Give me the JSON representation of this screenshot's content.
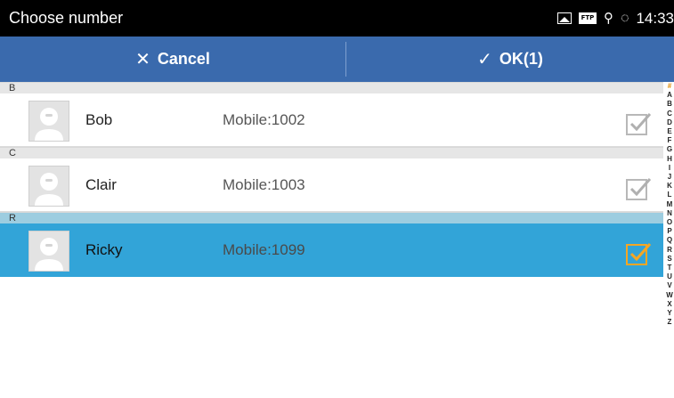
{
  "statusbar": {
    "title": "Choose number",
    "icons": [
      "picture-icon",
      "ftp-icon",
      "usb-icon",
      "sync-icon"
    ],
    "ftp_label": "FTP",
    "time": "14:33"
  },
  "actionbar": {
    "cancel_label": "Cancel",
    "ok_label": "OK(1)",
    "background": "#3a6aad"
  },
  "sections": [
    {
      "letter": "B",
      "contacts": [
        {
          "name": "Bob",
          "phone": "Mobile:1002",
          "checked": false
        }
      ]
    },
    {
      "letter": "C",
      "contacts": [
        {
          "name": "Clair",
          "phone": "Mobile:1003",
          "checked": false
        }
      ]
    },
    {
      "letter": "R",
      "contacts": [
        {
          "name": "Ricky",
          "phone": "Mobile:1099",
          "checked": true
        }
      ]
    }
  ],
  "index_letters": [
    "#",
    "A",
    "B",
    "C",
    "D",
    "E",
    "F",
    "G",
    "H",
    "I",
    "J",
    "K",
    "L",
    "M",
    "N",
    "O",
    "P",
    "Q",
    "R",
    "S",
    "T",
    "U",
    "V",
    "W",
    "X",
    "Y",
    "Z"
  ],
  "colors": {
    "selected_row": "#32a4d8",
    "selected_header": "#9dcde0",
    "check_on": "#f5a623",
    "check_off": "#b0b0b0"
  }
}
